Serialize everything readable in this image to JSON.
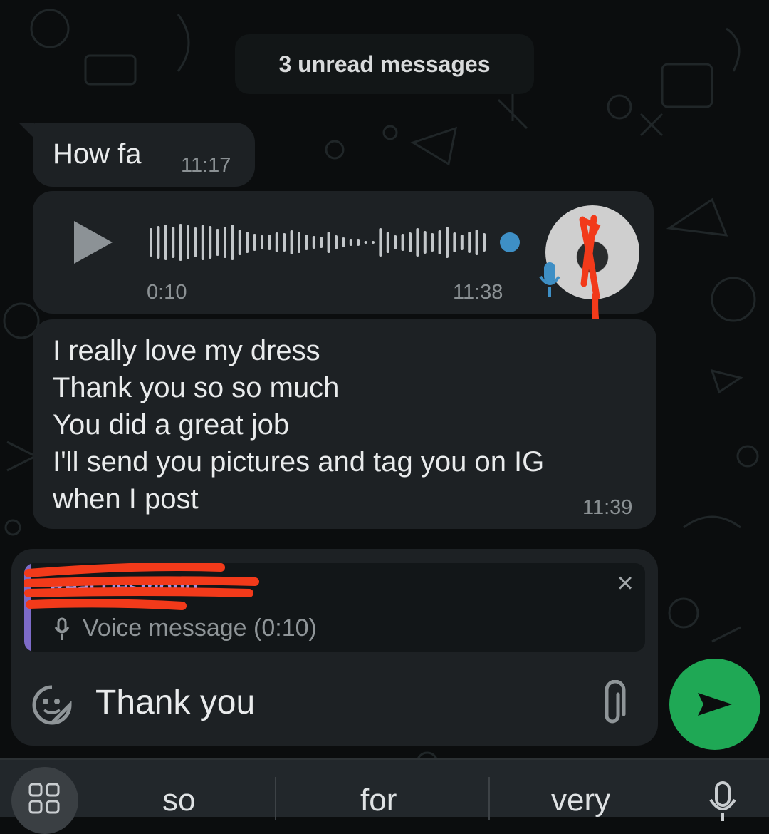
{
  "chat": {
    "unread_banner": "3 unread messages",
    "messages": [
      {
        "text": "How fa",
        "time": "11:17"
      },
      {
        "duration": "0:10",
        "time": "11:38"
      },
      {
        "lines": [
          "I really love my dress",
          "Thank you so so much",
          "You did a great job",
          "I'll send you pictures and tag you on IG",
          "when I post"
        ],
        "time": "11:39"
      }
    ]
  },
  "composer": {
    "reply": {
      "sender": "Real Desmond",
      "preview": "Voice message (0:10)",
      "close_symbol": "×"
    },
    "input_value": "Thank you"
  },
  "keyboard": {
    "suggestions": [
      "so",
      "for",
      "very"
    ]
  },
  "colors": {
    "send_button": "#1fa855",
    "reply_accent": "#7d6bc8",
    "redaction": "#f23a1a",
    "voice_progress": "#3e8fc5"
  },
  "icons": [
    "play-icon",
    "mic-icon",
    "emoji-sticker-icon",
    "paperclip-icon",
    "send-icon",
    "close-icon",
    "keyboard-grid-icon"
  ]
}
